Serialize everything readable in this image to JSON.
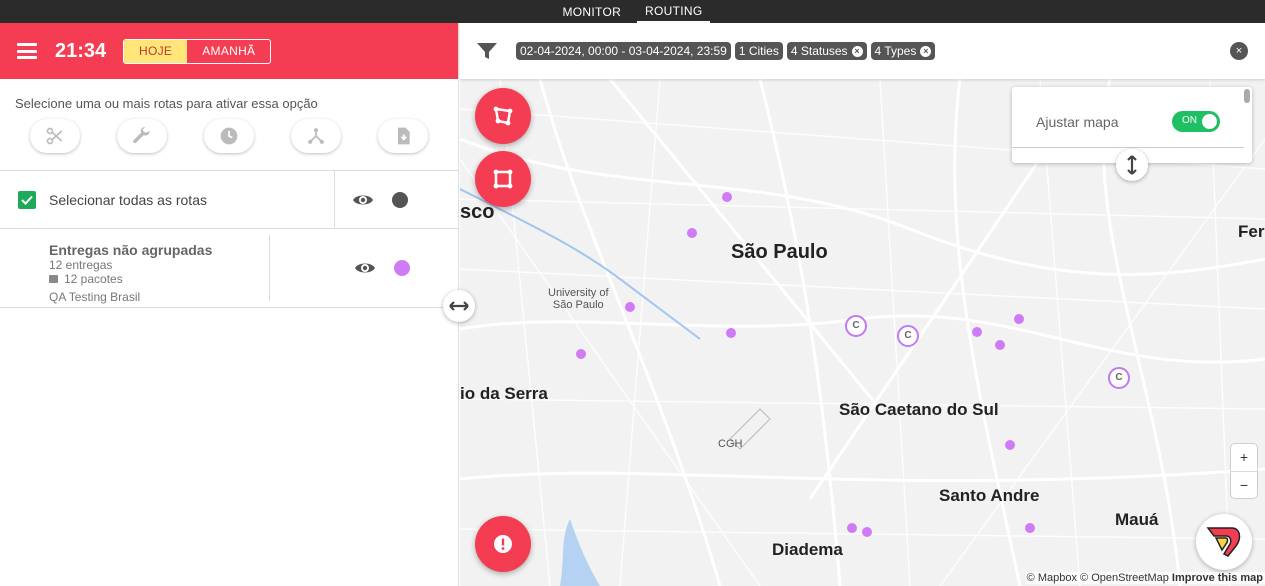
{
  "topnav": {
    "tabs": [
      {
        "label": "MONITOR",
        "active": false
      },
      {
        "label": "ROUTING",
        "active": true
      }
    ]
  },
  "header": {
    "time": "21:34",
    "day_options": [
      "HOJE",
      "AMANHÃ"
    ],
    "active_day": "HOJE",
    "accent_color": "#f43d52"
  },
  "toolbar": {
    "hint": "Selecione uma ou mais rotas para ativar essa opção",
    "tools": [
      "scissors-icon",
      "wrench-icon",
      "clock-icon",
      "route-icon",
      "download-file-icon"
    ]
  },
  "routes_panel": {
    "select_all_label": "Selecionar todas as rotas",
    "select_all_checked": true,
    "select_all_dot_color": "#555555",
    "routes": [
      {
        "title": "Entregas não agrupadas",
        "deliveries": "12 entregas",
        "packages": "12 pacotes",
        "company": "QA Testing Brasil",
        "color": "#cf7bf5"
      }
    ]
  },
  "filters": {
    "date_range": "02-04-2024, 00:00 - 03-04-2024, 23:59",
    "chips": [
      {
        "label": "1 Cities",
        "removable": false
      },
      {
        "label": "4 Statuses",
        "removable": true
      },
      {
        "label": "4 Types",
        "removable": true
      }
    ]
  },
  "map": {
    "labels": {
      "sao_paulo": "São Paulo",
      "usp": "University of\nSão Paulo",
      "sao_caetano": "São Caetano do Sul",
      "santo_andre": "Santo Andre",
      "diadema": "Diadema",
      "maua": "Mauá",
      "cgh": "CGH",
      "osasco_partial": "sco",
      "serra_partial": "io da Serra",
      "ferraz_partial": "Ferr"
    },
    "cluster_label": "C",
    "adjust_label": "Ajustar mapa",
    "adjust_toggle": "ON",
    "zoom_in": "+",
    "zoom_out": "−",
    "attribution_mapbox": "© Mapbox",
    "attribution_osm": "© OpenStreetMap",
    "attribution_improve": "Improve this map"
  }
}
